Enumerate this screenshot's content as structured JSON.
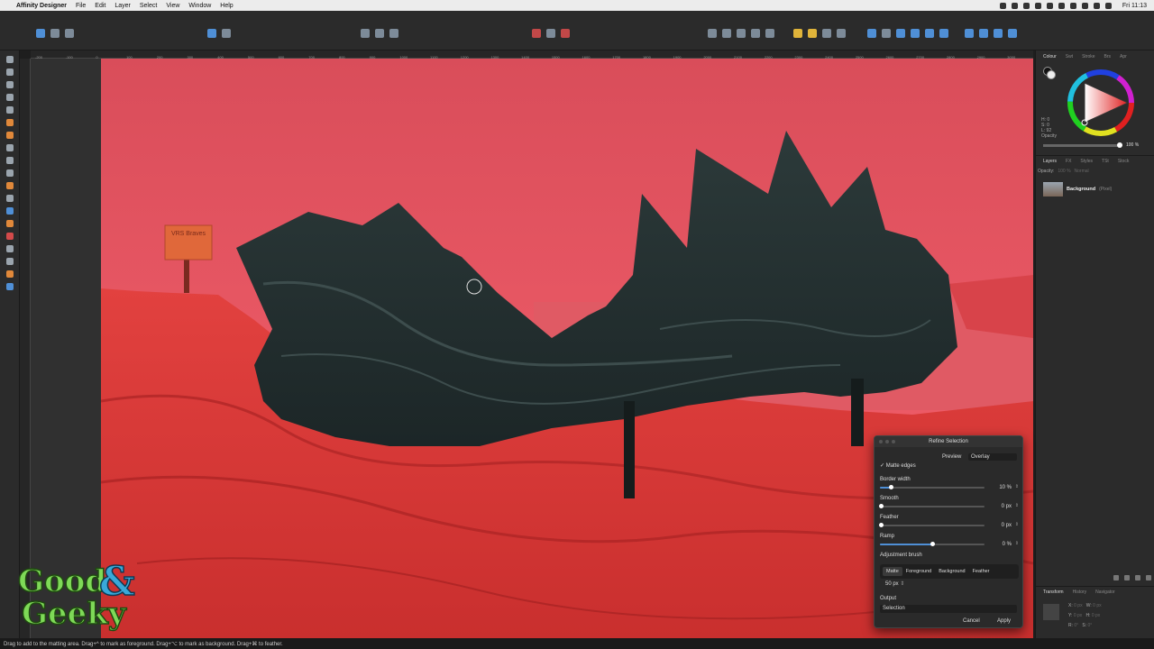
{
  "menubar": {
    "app_name": "Affinity Designer",
    "items": [
      "File",
      "Edit",
      "Layer",
      "Select",
      "View",
      "Window",
      "Help"
    ],
    "clock": "Fri 11:13"
  },
  "canvas": {
    "sign_text": "VRS Braves",
    "ruler_labels": [
      "-200",
      "-100",
      "0",
      "100",
      "200",
      "300",
      "400",
      "500",
      "600",
      "700",
      "800",
      "900",
      "1000",
      "1100",
      "1200",
      "1300",
      "1400",
      "1500",
      "1600",
      "1700",
      "1800",
      "1900",
      "2000",
      "2100",
      "2200",
      "2300",
      "2400",
      "2500",
      "2600",
      "2700",
      "2800",
      "2900",
      "3000"
    ]
  },
  "logo": {
    "line1": "Good",
    "line2": "Geeky",
    "ampersand": "&"
  },
  "colour_panel": {
    "tabs": [
      "Colour",
      "Swt",
      "Stroke",
      "Brs",
      "Apr"
    ],
    "h": "H: 0",
    "s": "S: 0",
    "l": "L: 92",
    "opacity_label": "Opacity",
    "opacity_value": "100 %"
  },
  "layers_panel": {
    "tabs": [
      "Layers",
      "FX",
      "Styles",
      "TSt",
      "Stock"
    ],
    "opacity_label": "Opacity:",
    "opacity_value": "100 %",
    "blend": "Normal",
    "layer_name": "Background",
    "layer_kind": "(Pixel)"
  },
  "transform_panel": {
    "tabs": [
      "Transform",
      "History",
      "Navigator"
    ],
    "x": "0 px",
    "y": "0 px",
    "w": "0 px",
    "h": "0 px",
    "r": "0°",
    "s": "0°"
  },
  "refine": {
    "title": "Refine Selection",
    "preview_label": "Preview",
    "preview_value": "Overlay",
    "matte_edges": "Matte edges",
    "border_width_label": "Border width",
    "border_width_value": "10 %",
    "border_width_level": 0.1,
    "smooth_label": "Smooth",
    "smooth_value": "0 px",
    "feather_label": "Feather",
    "feather_value": "0 px",
    "ramp_label": "Ramp",
    "ramp_value": "0 %",
    "ramp_level": 0.5,
    "adjustment_label": "Adjustment brush",
    "modes": [
      "Matte",
      "Foreground",
      "Background",
      "Feather"
    ],
    "brush_size": "50 px",
    "output_label": "Output",
    "output_value": "Selection",
    "cancel": "Cancel",
    "apply": "Apply"
  },
  "status": {
    "hint": "Drag to add to the matting area. Drag+^ to mark as foreground. Drag+⌥ to mark as background. Drag+⌘ to feather."
  }
}
